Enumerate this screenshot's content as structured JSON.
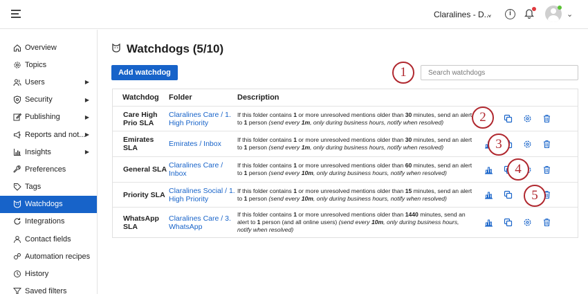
{
  "topbar": {
    "account_name": "Claralines - D...",
    "chevron_glyph": "⌄",
    "info_glyph": "i",
    "notification_color": "#e0393e",
    "online_color": "#5bc236"
  },
  "sidebar": {
    "items": [
      {
        "label": "Overview",
        "icon": "home-icon",
        "has_caret": false
      },
      {
        "label": "Topics",
        "icon": "gear-icon",
        "has_caret": false
      },
      {
        "label": "Users",
        "icon": "users-icon",
        "has_caret": true
      },
      {
        "label": "Security",
        "icon": "shield-icon",
        "has_caret": true
      },
      {
        "label": "Publishing",
        "icon": "edit-icon",
        "has_caret": true
      },
      {
        "label": "Reports and not...",
        "icon": "megaphone-icon",
        "has_caret": true
      },
      {
        "label": "Insights",
        "icon": "chart-icon",
        "has_caret": true
      },
      {
        "label": "Preferences",
        "icon": "wrench-icon",
        "has_caret": false
      },
      {
        "label": "Tags",
        "icon": "tag-icon",
        "has_caret": false
      },
      {
        "label": "Watchdogs",
        "icon": "watchdog-icon",
        "has_caret": false,
        "active": true
      },
      {
        "label": "Integrations",
        "icon": "refresh-icon",
        "has_caret": false
      },
      {
        "label": "Contact fields",
        "icon": "person-icon",
        "has_caret": false
      },
      {
        "label": "Automation recipes",
        "icon": "automation-icon",
        "has_caret": false
      },
      {
        "label": "History",
        "icon": "clock-icon",
        "has_caret": false
      },
      {
        "label": "Saved filters",
        "icon": "filter-icon",
        "has_caret": false
      }
    ],
    "caret_glyph": "▶",
    "active_color": "#1763c9"
  },
  "main": {
    "title": "Watchdogs (5/10)",
    "add_button_label": "Add watchdog",
    "search_placeholder": "Search watchdogs",
    "columns": [
      "Watchdog",
      "Folder",
      "Description"
    ],
    "rows": [
      {
        "name": "Care High Prio SLA",
        "folder": "Claralines Care / 1. High Priority",
        "d1": "If this folder contains ",
        "count": "1",
        "d2": " or more unresolved mentions older than ",
        "minutes": "30",
        "d3": " minutes, send an alert to ",
        "person": "1",
        "d4": " person ",
        "d5": "(send every ",
        "every": "1m",
        "d6": ", only during business hours, notify when resolved)",
        "actions": [
          "chart-icon",
          "copy-icon",
          "settings-icon",
          "trash-icon"
        ]
      },
      {
        "name": "Emirates SLA",
        "folder": "Emirates / Inbox",
        "d1": "If this folder contains ",
        "count": "1",
        "d2": " or more unresolved mentions older than ",
        "minutes": "30",
        "d3": " minutes, send an alert to ",
        "person": "1",
        "d4": " person ",
        "d5": "(send every ",
        "every": "1m",
        "d6": ", only during business hours, notify when resolved)",
        "actions": [
          "chart-icon",
          "copy-icon",
          "settings-icon",
          "trash-icon"
        ]
      },
      {
        "name": "General SLA",
        "folder": "Claralines Care / Inbox",
        "d1": "If this folder contains ",
        "count": "1",
        "d2": " or more unresolved mentions older than ",
        "minutes": "60",
        "d3": " minutes, send an alert to ",
        "person": "1",
        "d4": " person ",
        "d5": "(send every ",
        "every": "10m",
        "d6": ", only during business hours, notify when resolved)",
        "actions": [
          "chart-icon",
          "copy-icon",
          "settings-icon",
          "trash-icon"
        ]
      },
      {
        "name": "Priority SLA",
        "folder": "Claralines Social / 1. High Priority",
        "d1": "If this folder contains ",
        "count": "1",
        "d2": " or more unresolved mentions older than ",
        "minutes": "15",
        "d3": " minutes, send an alert to ",
        "person": "1",
        "d4": " person ",
        "d5": "(send every ",
        "every": "10m",
        "d6": ", only during business hours, notify when resolved)",
        "actions": [
          "chart-icon",
          "copy-icon",
          "settings-icon",
          "trash-icon"
        ]
      },
      {
        "name": "WhatsApp SLA",
        "folder": "Claralines Care / 3. WhatsApp",
        "d1": "If this folder contains ",
        "count": "1",
        "d2": " or more unresolved mentions older than ",
        "minutes": "1440",
        "d3": " minutes, send an alert to ",
        "person": "1",
        "d4": " person (and all online users) ",
        "d5": "(send every ",
        "every": "10m",
        "d6": ", only during business hours, notify when resolved)",
        "actions": [
          "chart-icon",
          "copy-icon",
          "settings-icon",
          "trash-icon"
        ]
      }
    ],
    "accent_color": "#1763c9"
  },
  "callouts": [
    "1",
    "2",
    "3",
    "4",
    "5"
  ],
  "callout_color": "#b0272e"
}
